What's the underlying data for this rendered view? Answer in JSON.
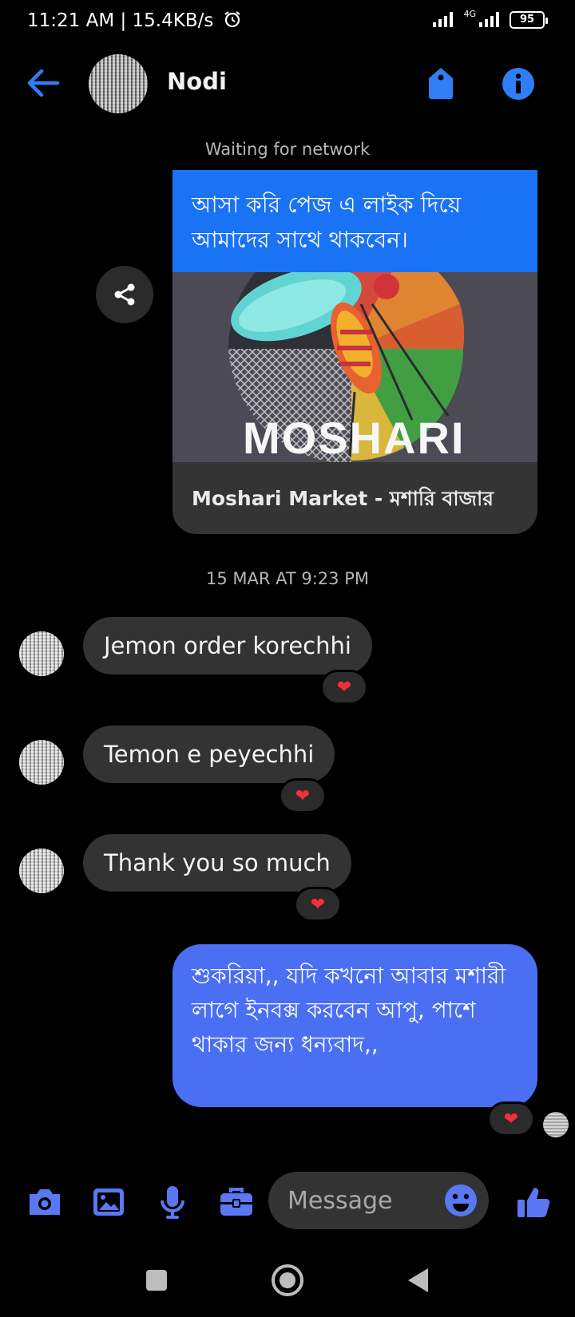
{
  "status_bar": {
    "time_speed": "11:21 AM | 15.4KB/s",
    "network": "4G",
    "battery": "95"
  },
  "header": {
    "contact_name": "Nodi"
  },
  "notice": "Waiting for network",
  "shared_post": {
    "text": "আসা করি পেজ এ লাইক  দিয়ে আমাদের সাথে থাকবেন।",
    "image_word": "MOSHARI",
    "link_title": "Moshari Market - মশারি বাজার"
  },
  "timestamp": "15 MAR AT 9:23 PM",
  "incoming_messages": [
    {
      "text": "Jemon order korechhi",
      "reaction": "❤"
    },
    {
      "text": "Temon e peyechhi",
      "reaction": "❤"
    },
    {
      "text": "Thank you so much",
      "reaction": "❤"
    }
  ],
  "outgoing_message": {
    "text": "শুকরিয়া,,  যদি কখনো আবার মশারী লাগে ইনবক্স করবেন আপু,  পাশে থাকার জন্য ধন্যবাদ,,",
    "reaction": "❤"
  },
  "composer": {
    "placeholder": "Message"
  },
  "colors": {
    "accent": "#1a73f5",
    "outgoing_bubble": "#4a6ff2",
    "incoming_bubble": "#333333",
    "heart": "#f0303a"
  }
}
